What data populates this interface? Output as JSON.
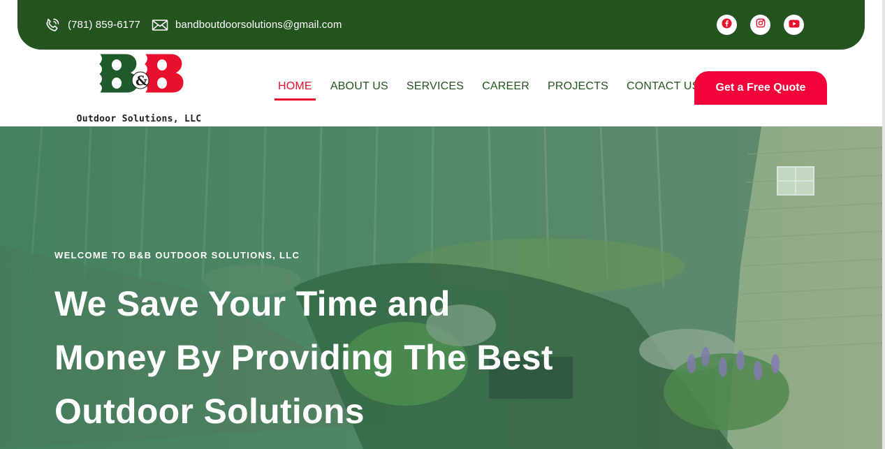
{
  "topbar": {
    "phone": "(781) 859-6177",
    "email": "bandboutdoorsolutions@gmail.com",
    "socials": [
      "facebook-icon",
      "instagram-icon",
      "youtube-icon"
    ],
    "background_color": "#23541f"
  },
  "header": {
    "logo_letters": "B&B",
    "logo_text": "Outdoor Solutions, LLC",
    "nav": [
      {
        "label": "HOME",
        "active": true
      },
      {
        "label": "ABOUT US",
        "active": false
      },
      {
        "label": "SERVICES",
        "active": false
      },
      {
        "label": "CAREER",
        "active": false
      },
      {
        "label": "PROJECTS",
        "active": false
      },
      {
        "label": "CONTACT US",
        "active": false
      }
    ],
    "cta_label": "Get a Free Quote",
    "accent_color": "#e8112d",
    "nav_color": "#23541f"
  },
  "hero": {
    "welcome": "WELCOME TO B&B OUTDOOR SOLUTIONS, LLC",
    "headline_lines": [
      "We Save Your Time and",
      "Money By Providing The Best",
      "Outdoor Solutions"
    ]
  }
}
